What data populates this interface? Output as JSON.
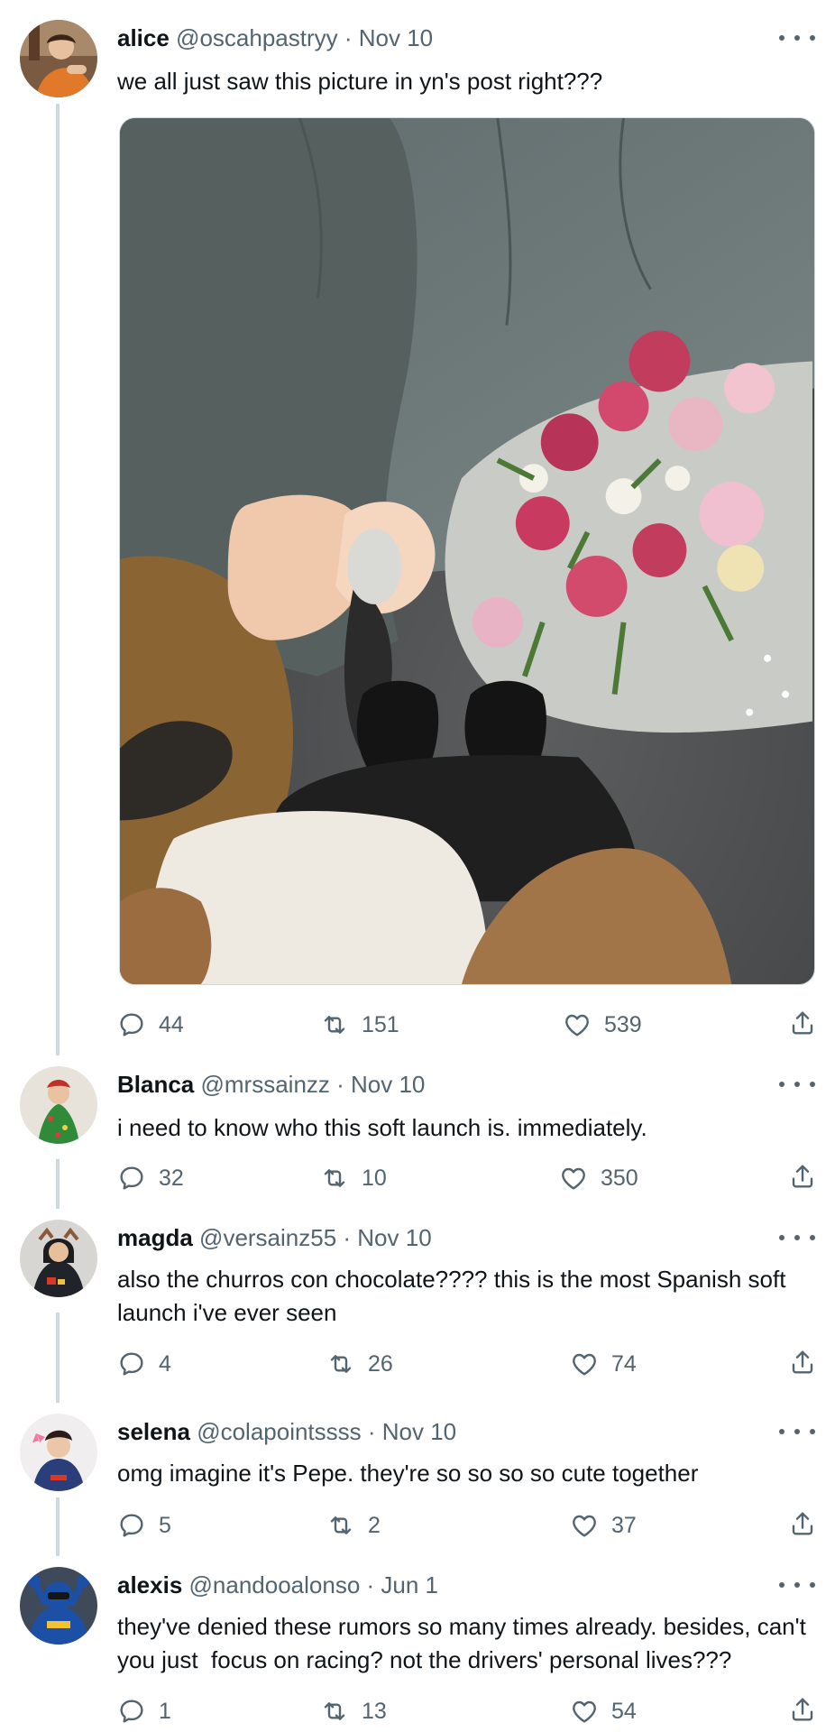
{
  "tweets": [
    {
      "name": "alice",
      "meta": "@oscahpastryy · Nov 10",
      "text": "we all just saw this picture in yn's post right???",
      "replies": "44",
      "retweets": "151",
      "likes": "539",
      "image_alt": "photo"
    },
    {
      "name": "Blanca",
      "meta": "@mrssainzz · Nov 10",
      "text": "i need to know who this soft launch is. immediately.",
      "replies": "32",
      "retweets": "10",
      "likes": "350"
    },
    {
      "name": "magda",
      "meta": "@versainz55 · Nov 10",
      "text": "also the churros con chocolate???? this is the most Spanish soft launch i've ever seen",
      "replies": "4",
      "retweets": "26",
      "likes": "74"
    },
    {
      "name": "selena",
      "meta": "@colapointssss · Nov 10",
      "text": "omg imagine it's Pepe. they're so so so so cute together",
      "replies": "5",
      "retweets": "2",
      "likes": "37"
    },
    {
      "name": "alexis",
      "meta": "@nandooalonso · Jun 1",
      "text": "they've denied these rumors so many times already. besides, can't you just  focus on racing? not the drivers' personal lives???",
      "replies": "1",
      "retweets": "13",
      "likes": "54"
    }
  ],
  "icons": {
    "reply": "reply-icon",
    "retweet": "retweet-icon",
    "like": "heart-icon",
    "share": "share-icon",
    "more": "more-icon"
  },
  "colors": {
    "text_primary": "#0f1419",
    "text_secondary": "#536471",
    "thread_line": "#cfd9de"
  }
}
